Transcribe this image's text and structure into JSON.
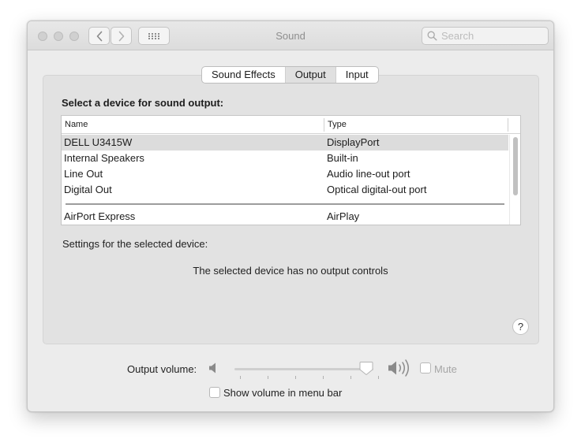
{
  "window": {
    "title": "Sound",
    "search_placeholder": "Search"
  },
  "tabs": [
    {
      "label": "Sound Effects",
      "active": false
    },
    {
      "label": "Output",
      "active": true
    },
    {
      "label": "Input",
      "active": false
    }
  ],
  "output": {
    "heading": "Select a device for sound output:",
    "columns": {
      "name": "Name",
      "type": "Type"
    },
    "devices": [
      {
        "name": "DELL U3415W",
        "type": "DisplayPort",
        "selected": true
      },
      {
        "name": "Internal Speakers",
        "type": "Built-in",
        "selected": false
      },
      {
        "name": "Line Out",
        "type": "Audio line-out port",
        "selected": false
      },
      {
        "name": "Digital Out",
        "type": "Optical digital-out port",
        "selected": false
      },
      {
        "name": "AirPort Express",
        "type": "AirPlay",
        "selected": false
      }
    ],
    "settings_label": "Settings for the selected device:",
    "no_controls_message": "The selected device has no output controls",
    "help_label": "?"
  },
  "volume": {
    "label": "Output volume:",
    "level": 0.95,
    "mute_label": "Mute",
    "mute_checked": false,
    "show_in_menu_bar_label": "Show volume in menu bar",
    "show_in_menu_bar_checked": false
  },
  "icons": {
    "traffic_lights": [
      "close-dot",
      "minimize-dot",
      "zoom-dot"
    ],
    "back": "chevron-left-icon",
    "forward": "chevron-right-icon",
    "grid": "grid-icon",
    "search": "magnifier-icon",
    "speaker_low": "speaker-low-icon",
    "speaker_high": "speaker-high-icon"
  }
}
